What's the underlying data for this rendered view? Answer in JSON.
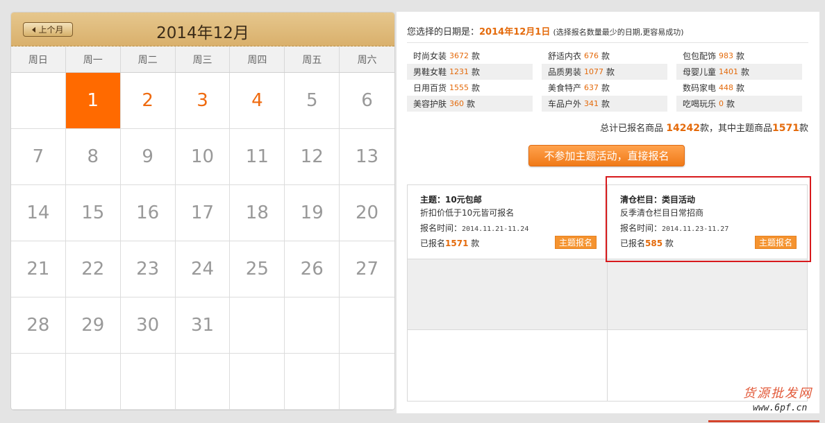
{
  "calendar": {
    "prev_label": "上个月",
    "title": "2014年12月",
    "weekdays": [
      "周日",
      "周一",
      "周二",
      "周三",
      "周四",
      "周五",
      "周六"
    ],
    "days": [
      "",
      "1",
      "2",
      "3",
      "4",
      "5",
      "6",
      "7",
      "8",
      "9",
      "10",
      "11",
      "12",
      "13",
      "14",
      "15",
      "16",
      "17",
      "18",
      "19",
      "20",
      "21",
      "22",
      "23",
      "24",
      "25",
      "26",
      "27",
      "28",
      "29",
      "30",
      "31",
      "",
      "",
      "",
      "",
      "",
      "",
      "",
      "",
      "",
      ""
    ],
    "selected_day": "1",
    "available_days": [
      "2",
      "3",
      "4"
    ]
  },
  "selection": {
    "prefix": "您选择的日期是：",
    "date": "2014年12月1日",
    "note": "(选择报名数量最少的日期,更容易成功)"
  },
  "categories": [
    [
      {
        "name": "时尚女装",
        "count": "3672",
        "unit": "款"
      },
      {
        "name": "舒适内衣",
        "count": "676",
        "unit": "款"
      },
      {
        "name": "包包配饰",
        "count": "983",
        "unit": "款"
      }
    ],
    [
      {
        "name": "男鞋女鞋",
        "count": "1231",
        "unit": "款"
      },
      {
        "name": "品质男装",
        "count": "1077",
        "unit": "款"
      },
      {
        "name": "母婴儿童",
        "count": "1401",
        "unit": "款"
      }
    ],
    [
      {
        "name": "日用百货",
        "count": "1555",
        "unit": "款"
      },
      {
        "name": "美食特产",
        "count": "637",
        "unit": "款"
      },
      {
        "name": "数码家电",
        "count": "448",
        "unit": "款"
      }
    ],
    [
      {
        "name": "美容护肤",
        "count": "360",
        "unit": "款"
      },
      {
        "name": "车品户外",
        "count": "341",
        "unit": "款"
      },
      {
        "name": "吃喝玩乐",
        "count": "0",
        "unit": "款"
      }
    ]
  ],
  "total": {
    "prefix": "总计已报名商品",
    "count": "14242",
    "mid": "款，其中主题商品",
    "theme_count": "1571",
    "suffix": "款"
  },
  "skip_button": "不参加主题活动，直接报名",
  "themes": [
    {
      "title": "主题：10元包邮",
      "desc": "折扣价低于10元皆可报名",
      "time_label": "报名时间：",
      "time": "2014.11.21-11.24",
      "count_prefix": "已报名",
      "count": "1571",
      "count_suffix": "款",
      "button": "主题报名"
    },
    {
      "title": "清仓栏目：类目活动",
      "desc": "反季清仓栏目日常招商",
      "time_label": "报名时间：",
      "time": "2014.11.23-11.27",
      "count_prefix": "已报名",
      "count": "585",
      "count_suffix": "款",
      "button": "主题报名"
    }
  ],
  "watermark": {
    "title": "货源批发网",
    "url": "www.6pf.cn"
  }
}
